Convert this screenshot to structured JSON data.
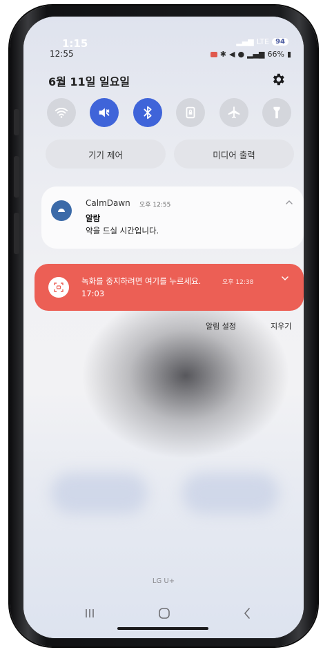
{
  "status_bar": {
    "time_overlay": "1:15",
    "time": "12:55",
    "network": "LTE",
    "signal_badge": "94",
    "battery": "66%"
  },
  "quick_settings": {
    "date": "6월 11일 일요일",
    "toggles": [
      {
        "name": "wifi-icon",
        "state": "off"
      },
      {
        "name": "mute-icon",
        "state": "on"
      },
      {
        "name": "bluetooth-icon",
        "state": "on"
      },
      {
        "name": "lock-rotation-icon",
        "state": "off"
      },
      {
        "name": "airplane-icon",
        "state": "off"
      },
      {
        "name": "flashlight-icon",
        "state": "off"
      }
    ],
    "device_control_label": "기기 제어",
    "media_output_label": "미디어 출력"
  },
  "notification": {
    "app_name": "CalmDawn",
    "time": "오후 12:55",
    "title": "알람",
    "body": "약을 드실 시간입니다."
  },
  "recording": {
    "title": "녹화를 중지하려면 여기를 누르세요.",
    "time": "오후 12:38",
    "elapsed": "17:03",
    "color": "#ec5f55"
  },
  "actions": {
    "notification_settings": "알림 설정",
    "clear": "지우기"
  },
  "carrier": "LG U+",
  "colors": {
    "toggle_on": "#3f64d9",
    "toggle_off": "#d4d6dc"
  }
}
